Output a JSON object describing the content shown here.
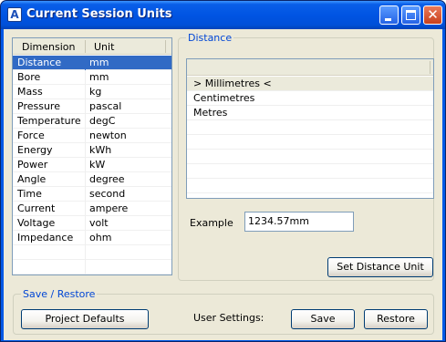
{
  "window": {
    "title": "Current Session Units",
    "app_icon_glyph": "A"
  },
  "titlebar_buttons": {
    "minimize_icon": "minimize-icon",
    "maximize_icon": "maximize-icon",
    "close_icon": "close-icon",
    "close_glyph": "✕"
  },
  "units_table": {
    "columns": [
      "Dimension",
      "Unit"
    ],
    "rows": [
      {
        "dimension": "Distance",
        "unit": "mm"
      },
      {
        "dimension": "Bore",
        "unit": "mm"
      },
      {
        "dimension": "Mass",
        "unit": "kg"
      },
      {
        "dimension": "Pressure",
        "unit": "pascal"
      },
      {
        "dimension": "Temperature",
        "unit": "degC"
      },
      {
        "dimension": "Force",
        "unit": "newton"
      },
      {
        "dimension": "Energy",
        "unit": "kWh"
      },
      {
        "dimension": "Power",
        "unit": "kW"
      },
      {
        "dimension": "Angle",
        "unit": "degree"
      },
      {
        "dimension": "Time",
        "unit": "second"
      },
      {
        "dimension": "Current",
        "unit": "ampere"
      },
      {
        "dimension": "Voltage",
        "unit": "volt"
      },
      {
        "dimension": "Impedance",
        "unit": "ohm"
      },
      {
        "dimension": "",
        "unit": ""
      },
      {
        "dimension": "",
        "unit": ""
      }
    ],
    "selected_index": 0
  },
  "distance_group": {
    "label": "Distance",
    "choices": [
      "> Millimetres <",
      "Centimetres",
      "Metres"
    ],
    "empty_rows": 5,
    "example_label": "Example",
    "example_value": "1234.57mm",
    "set_button": "Set Distance Unit"
  },
  "save_restore": {
    "label": "Save / Restore",
    "project_defaults_button": "Project Defaults",
    "user_settings_label": "User Settings:",
    "save_button": "Save",
    "restore_button": "Restore"
  },
  "colors": {
    "titlebar": "#0054e3",
    "selection": "#316ac5",
    "group_label": "#0046d5",
    "dialog_bg": "#ece9d8"
  }
}
